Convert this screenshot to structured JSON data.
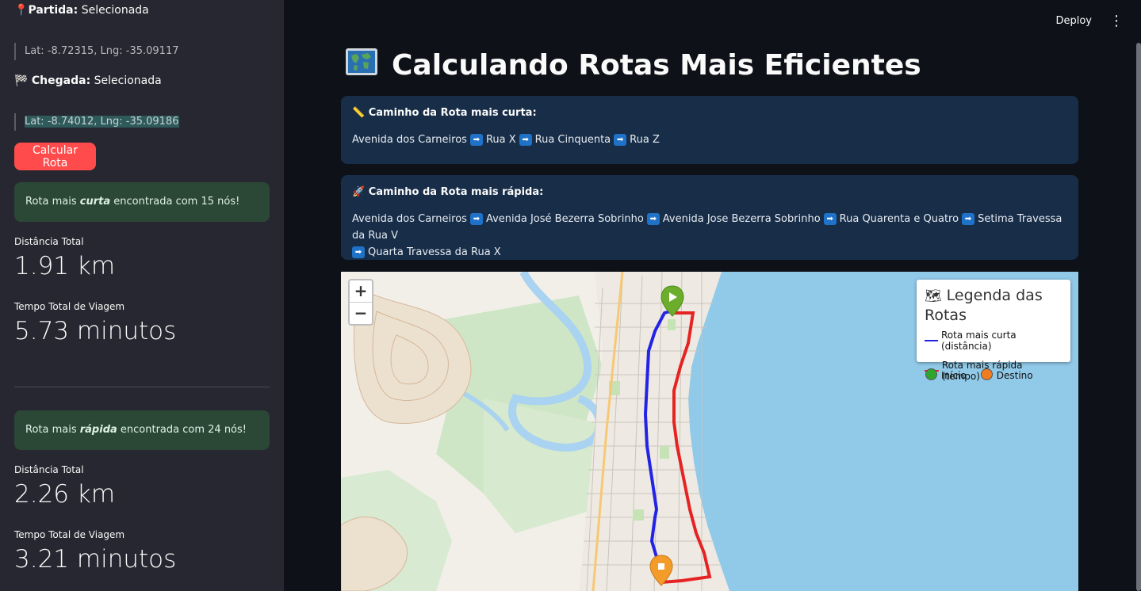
{
  "sidebar": {
    "start_label": "Partida:",
    "start_value": "Selecionada",
    "start_coords": "Lat: -8.72315, Lng: -35.09117",
    "end_label": "Chegada:",
    "end_value": "Selecionada",
    "end_coords": "Lat: -8.74012, Lng: -35.09186",
    "calc_button": "Calcular Rota",
    "short": {
      "msg_pre": "Rota mais ",
      "msg_em": "curta",
      "msg_post": " encontrada com 15 nós!",
      "dist_label": "Distância Total",
      "dist_value": "1.91 km",
      "time_label": "Tempo Total de Viagem",
      "time_value": "5.73 minutos"
    },
    "fast": {
      "msg_pre": "Rota mais ",
      "msg_em": "rápida",
      "msg_post": " encontrada com 24 nós!",
      "dist_label": "Distância Total",
      "dist_value": "2.26 km",
      "time_label": "Tempo Total de Viagem",
      "time_value": "3.21 minutos"
    }
  },
  "header": {
    "deploy": "Deploy"
  },
  "main": {
    "title": "Calculando Rotas Mais Eficientes",
    "shortest": {
      "title": "Caminho da Rota mais curta:",
      "path": [
        "Avenida dos Carneiros",
        "Rua X",
        "Rua Cinquenta",
        "Rua Z"
      ]
    },
    "fastest": {
      "title": "Caminho da Rota mais rápida:",
      "path": [
        "Avenida dos Carneiros",
        "Avenida José Bezerra Sobrinho",
        "Avenida Jose Bezerra Sobrinho",
        "Rua Quarenta e Quatro",
        "Setima Travessa da Rua V",
        "Quarta Travessa da Rua X"
      ]
    }
  },
  "map": {
    "zoom_in": "+",
    "zoom_out": "−",
    "legend_title": "Legenda das Rotas",
    "legend_short": "Rota mais curta (distância)",
    "legend_fast": "Rota mais rápida (tempo)",
    "legend_start": "Início",
    "legend_end": "Destino",
    "colors": {
      "short": "#2323e6",
      "fast": "#e62323",
      "start": "#2fa52f",
      "end": "#f07c22"
    }
  },
  "icons": {
    "start": "pin-icon",
    "end": "checkered-flag-icon",
    "title": "world-map-icon",
    "shortest": "ruler-icon",
    "fastest": "rocket-icon"
  }
}
